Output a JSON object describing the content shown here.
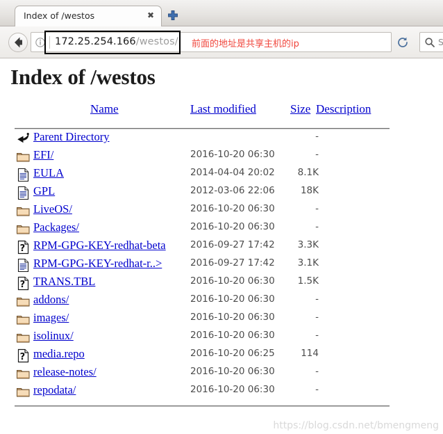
{
  "browser": {
    "tab": {
      "title": "Index of /westos",
      "close_label": "✖",
      "new_tab_icon": "plus-icon"
    },
    "toolbar": {
      "back_icon": "back-arrow-icon",
      "info_icon": "info-icon",
      "reload_icon": "reload-icon",
      "search_icon": "search-icon",
      "search_placeholder": "S",
      "url_host": "172.25.254.166",
      "url_path": "/westos/"
    },
    "annotation": {
      "note": "前面的地址是共享主机的ip",
      "note_color": "#f0463c",
      "box_color": "#000000"
    }
  },
  "page": {
    "title": "Index of /westos",
    "link_color": "#0000cd",
    "headers": {
      "name": "Name",
      "last_modified": "Last modified",
      "size": "Size",
      "description": "Description"
    },
    "rows": [
      {
        "icon": "parent-directory-icon",
        "name": "Parent Directory",
        "last_modified": "",
        "size": "-"
      },
      {
        "icon": "folder-icon",
        "name": "EFI/",
        "last_modified": "2016-10-20 06:30",
        "size": "-"
      },
      {
        "icon": "text-file-icon",
        "name": "EULA",
        "last_modified": "2014-04-04 20:02",
        "size": "8.1K"
      },
      {
        "icon": "text-file-icon",
        "name": "GPL",
        "last_modified": "2012-03-06 22:06",
        "size": "18K"
      },
      {
        "icon": "folder-icon",
        "name": "LiveOS/",
        "last_modified": "2016-10-20 06:30",
        "size": "-"
      },
      {
        "icon": "folder-icon",
        "name": "Packages/",
        "last_modified": "2016-10-20 06:30",
        "size": "-"
      },
      {
        "icon": "unknown-file-icon",
        "name": "RPM-GPG-KEY-redhat-beta",
        "last_modified": "2016-09-27 17:42",
        "size": "3.3K"
      },
      {
        "icon": "text-file-icon",
        "name": "RPM-GPG-KEY-redhat-r..>",
        "last_modified": "2016-09-27 17:42",
        "size": "3.1K"
      },
      {
        "icon": "unknown-file-icon",
        "name": "TRANS.TBL",
        "last_modified": "2016-10-20 06:30",
        "size": "1.5K"
      },
      {
        "icon": "folder-icon",
        "name": "addons/",
        "last_modified": "2016-10-20 06:30",
        "size": "-"
      },
      {
        "icon": "folder-icon",
        "name": "images/",
        "last_modified": "2016-10-20 06:30",
        "size": "-"
      },
      {
        "icon": "folder-icon",
        "name": "isolinux/",
        "last_modified": "2016-10-20 06:30",
        "size": "-"
      },
      {
        "icon": "unknown-file-icon",
        "name": "media.repo",
        "last_modified": "2016-10-20 06:25",
        "size": "114"
      },
      {
        "icon": "folder-icon",
        "name": "release-notes/",
        "last_modified": "2016-10-20 06:30",
        "size": "-"
      },
      {
        "icon": "folder-icon",
        "name": "repodata/",
        "last_modified": "2016-10-20 06:30",
        "size": "-"
      }
    ]
  },
  "watermark": "https://blog.csdn.net/bmengmeng"
}
